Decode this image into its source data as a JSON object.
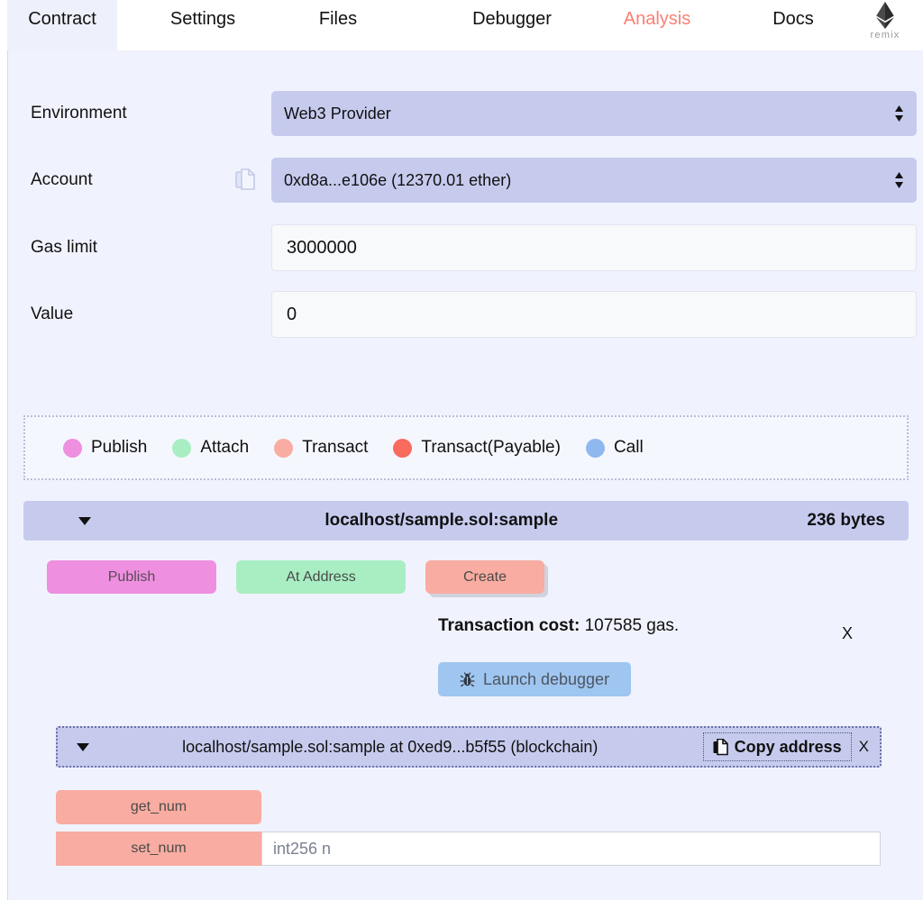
{
  "tabs": [
    {
      "label": "Contract",
      "active": true,
      "accent": false
    },
    {
      "label": "Settings",
      "active": false,
      "accent": false
    },
    {
      "label": "Files",
      "active": false,
      "accent": false
    },
    {
      "label": "Debugger",
      "active": false,
      "accent": false
    },
    {
      "label": "Analysis",
      "active": false,
      "accent": true
    },
    {
      "label": "Docs",
      "active": false,
      "accent": false
    }
  ],
  "logo": {
    "icon": "ethereum-diamond-icon",
    "text": "remix"
  },
  "form": {
    "environment": {
      "label": "Environment",
      "value": "Web3 Provider",
      "control": "select"
    },
    "account": {
      "label": "Account",
      "value": "0xd8a...e106e (12370.01 ether)",
      "control": "select",
      "copy_icon": "copy-documents-icon"
    },
    "gas_limit": {
      "label": "Gas limit",
      "value": "3000000",
      "control": "text"
    },
    "value": {
      "label": "Value",
      "value": "0",
      "control": "text"
    }
  },
  "legend": [
    {
      "label": "Publish",
      "color": "#ef8fe0"
    },
    {
      "label": "Attach",
      "color": "#a9eec3"
    },
    {
      "label": "Transact",
      "color": "#f9aca1"
    },
    {
      "label": "Transact(Payable)",
      "color": "#f96b5e"
    },
    {
      "label": "Call",
      "color": "#8fb8ee"
    }
  ],
  "contract": {
    "caret_icon": "chevron-down-icon",
    "title": "localhost/sample.sol:sample",
    "bytes": "236 bytes",
    "buttons": {
      "publish": "Publish",
      "at_address": "At Address",
      "create": "Create"
    }
  },
  "transaction": {
    "cost_label": "Transaction cost:",
    "cost_value": "107585 gas.",
    "close_label": "X",
    "debugger_button": "Launch debugger",
    "debugger_icon": "bug-icon"
  },
  "instance": {
    "caret_icon": "chevron-down-icon",
    "title": "localhost/sample.sol:sample at 0xed9...b5f55 (blockchain)",
    "copy_button": "Copy address",
    "copy_icon": "copy-documents-icon",
    "close_label": "X"
  },
  "functions": [
    {
      "name": "get_num",
      "has_input": false,
      "placeholder": ""
    },
    {
      "name": "set_num",
      "has_input": true,
      "placeholder": "int256 n"
    }
  ],
  "colors": {
    "panel_bg": "#f0f3fd",
    "select_bg": "#c6cbee",
    "accent_salmon": "#fb7f74",
    "debugger_blue": "#9ec6f0"
  }
}
